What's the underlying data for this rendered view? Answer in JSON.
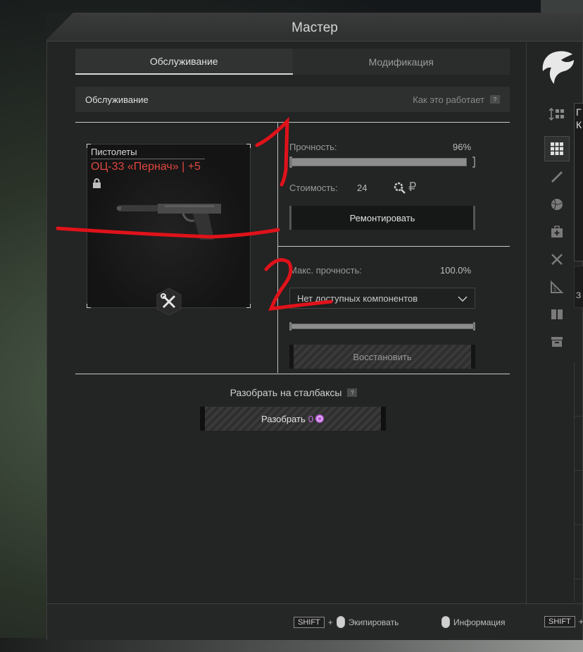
{
  "window": {
    "title": "Мастер"
  },
  "tabs": [
    {
      "label": "Обслуживание",
      "active": true
    },
    {
      "label": "Модификация",
      "active": false
    }
  ],
  "section": {
    "title": "Обслуживание",
    "help_link": "Как это работает",
    "help_icon": "?"
  },
  "weapon": {
    "category": "Пистолеты",
    "name": "ОЦ-33 «Пернач» | +5",
    "name_color": "#e0463f",
    "lock_icon": "lock-icon",
    "tool_icon": "wrench-screwdriver-icon"
  },
  "repair": {
    "durability_label": "Прочность:",
    "durability_value": "96%",
    "durability_fraction": 0.96,
    "cost_label": "Стоимость:",
    "cost_value": "24",
    "cost_icons": [
      "gear-search-icon",
      "ruble-icon"
    ],
    "button_label": "Ремонтировать"
  },
  "restore": {
    "max_label": "Макс. прочность:",
    "max_value": "100.0%",
    "dropdown_value": "Нет доступных компонентов",
    "button_label": "Восстановить"
  },
  "disassemble": {
    "title": "Разобрать на сталбаксы",
    "help_icon": "?",
    "button_label": "Разобрать",
    "amount": "0",
    "amount_color": "#c86ee0"
  },
  "sidebar": {
    "icons": [
      "sort-icon",
      "grid-icon",
      "weapon-icon",
      "ball-icon",
      "medkit-icon",
      "tools-icon",
      "ruler-icon",
      "book-icon",
      "box-icon"
    ],
    "active_index": 1
  },
  "footer": {
    "hints": [
      {
        "key": "SHIFT",
        "plus": "+",
        "label": "Экипировать"
      },
      {
        "label": "Информация"
      },
      {
        "key": "SHIFT",
        "plus": "+"
      }
    ]
  },
  "edge": {
    "letter_a": "Г",
    "letter_b": "К",
    "letter_c": "З"
  },
  "annotations": {
    "one": "1",
    "two": "2",
    "color": "#e0121a"
  }
}
